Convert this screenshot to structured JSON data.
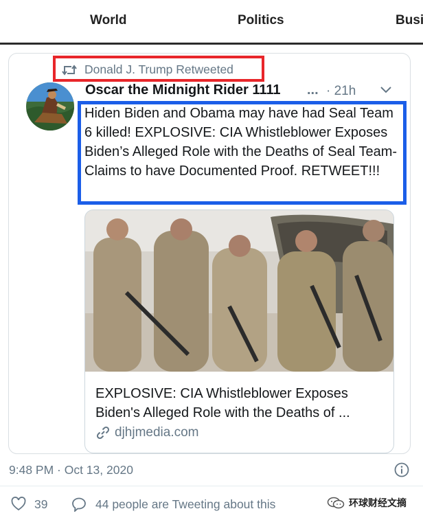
{
  "nav": {
    "items": [
      "World",
      "Politics",
      "Busi"
    ]
  },
  "tweet": {
    "retweet_label": "Donald J. Trump Retweeted",
    "author_name": "Oscar the Midnight Rider 1111",
    "name_truncation": "...",
    "time_ago": "· 21h",
    "text": "Hiden Biden and Obama may have had Seal Team 6 killed! EXPLOSIVE: CIA Whistleblower Exposes Biden’s Alleged Role with the Deaths of Seal Team- Claims to have Documented Proof. RETWEET!!!",
    "link_card": {
      "title_line1": "EXPLOSIVE: CIA Whistleblower Exposes",
      "title_line2": "Biden's Alleged Role with the Deaths of ...",
      "domain": "djhjmedia.com"
    },
    "timestamp": "9:48 PM · Oct 13, 2020",
    "like_count": "39",
    "reply_text": "44 people are Tweeting about this"
  },
  "watermark": {
    "text": "环球财经文摘"
  },
  "icons": {
    "retweet": "retweet-icon",
    "caret": "chevron-down-icon",
    "link": "link-icon",
    "info": "info-icon",
    "like": "heart-icon",
    "reply": "speech-bubble-icon",
    "watermark": "wechat-icon"
  },
  "colors": {
    "highlight_red": "#e8262a",
    "highlight_blue": "#1b5ee8",
    "secondary_text": "#657786",
    "primary_text": "#14171a"
  }
}
